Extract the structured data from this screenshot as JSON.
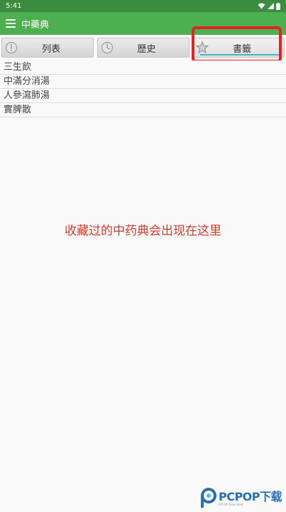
{
  "status_bar": {
    "time": "5:41"
  },
  "app_bar": {
    "title": "中藥典",
    "menu_icon": "menu-icon"
  },
  "tabs": [
    {
      "label": "列表",
      "icon": "list-icon",
      "active": false
    },
    {
      "label": "歷史",
      "icon": "clock-icon",
      "active": false
    },
    {
      "label": "書籤",
      "icon": "star-icon",
      "active": true
    }
  ],
  "list_items": [
    "三生飲",
    "中滿分消湯",
    "人參瀉肺湯",
    "實脾散"
  ],
  "annotation": "收藏过的中药典会出现在这里",
  "watermark": {
    "text": "PCPOP下载",
    "sub": "PCPOP Download"
  },
  "colors": {
    "status_bar": "#3c8c3f",
    "app_bar": "#4caf50",
    "highlight": "#e8211e",
    "annotation": "#d63a2a",
    "tab_indicator": "#4ab3c2"
  }
}
